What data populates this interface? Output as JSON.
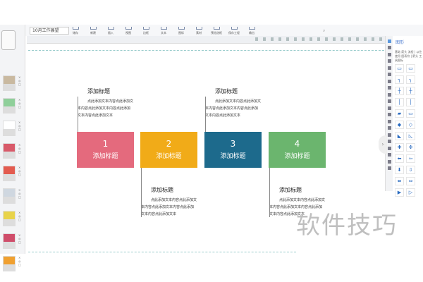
{
  "title_input": "10月工作展望",
  "toolbar": [
    "储存",
    "新建",
    "插入",
    "视图",
    "边框",
    "文本",
    "图标",
    "素材",
    "预览选框",
    "保存工程",
    "输出"
  ],
  "right_panel": {
    "title": "图形",
    "tabs": "基础 箭头 流程 | 以往使用 图表符 | 箭头 工具图标"
  },
  "shapes": [
    "▭",
    "▭",
    "┐",
    "╮",
    "┼",
    "┼",
    "│",
    "│",
    "▰",
    "▭",
    "◆",
    "◇",
    "◣",
    "◺",
    "✚",
    "✜",
    "⬅",
    "⇦",
    "⬇",
    "⇩",
    "⬌",
    "⇔",
    "▶",
    "▷"
  ],
  "expand_icon": "›",
  "steps": [
    {
      "number": "1",
      "label": "添加标题",
      "color": "#e46a7d"
    },
    {
      "number": "2",
      "label": "添加标题",
      "color": "#f1ab18"
    },
    {
      "number": "3",
      "label": "添加标题",
      "color": "#1d6a8c"
    },
    {
      "number": "4",
      "label": "添加标题",
      "color": "#6bb56e"
    }
  ],
  "notes": [
    {
      "title": "添加标题",
      "lines": [
        "点此添加文本内容点此添加文",
        "本内容点此添加文本内容点此添加",
        "文本内容点此添加文本"
      ]
    },
    {
      "title": "添加标题",
      "lines": [
        "点此添加文本内容点此添加文",
        "本内容点此添加文本内容点此添加",
        "文本内容点此添加文本"
      ]
    },
    {
      "title": "添加标题",
      "lines": [
        "点此添加文本内容点此添加文",
        "本内容点此添加文本内容点此添加",
        "文本内容点此添加文本"
      ]
    },
    {
      "title": "添加标题",
      "lines": [
        "点此添加文本内容点此添加文",
        "本内容点此添加文本内容点此添加",
        "文本内容点此添加文本"
      ]
    }
  ],
  "watermark": "软件技巧"
}
